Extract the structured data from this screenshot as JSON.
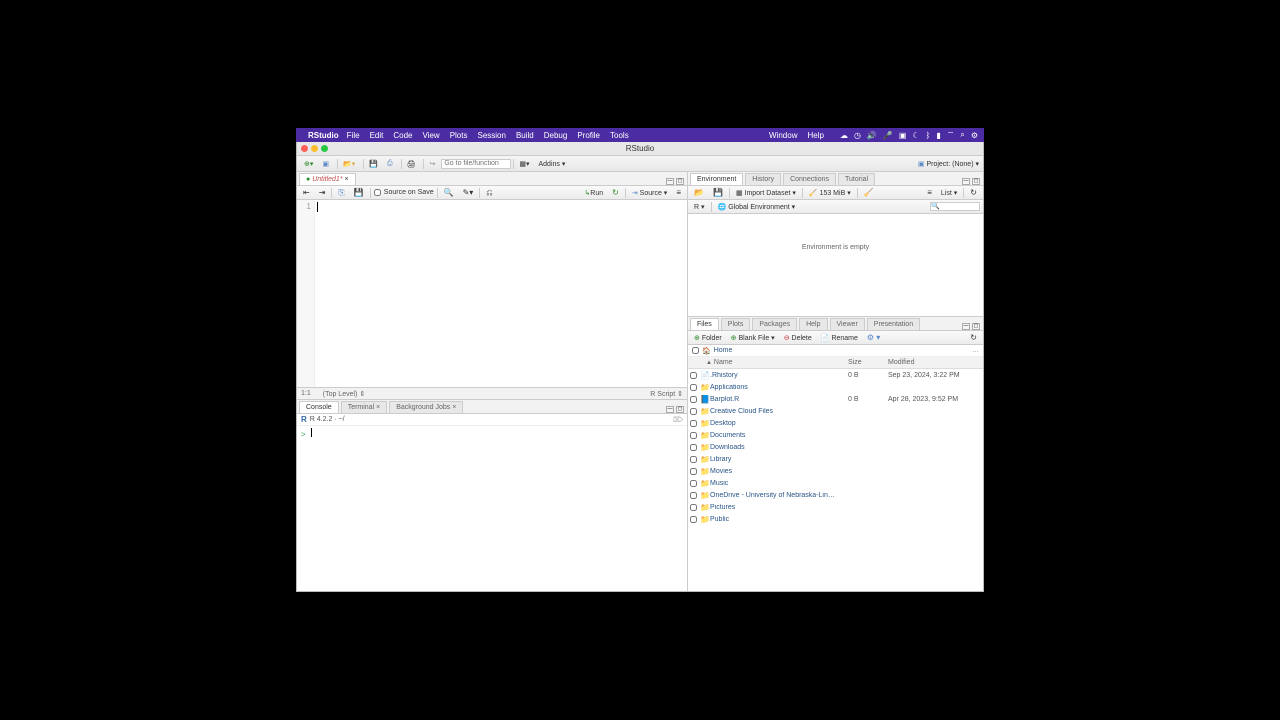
{
  "menubar": {
    "app": "RStudio",
    "items": [
      "File",
      "Edit",
      "Code",
      "View",
      "Plots",
      "Session",
      "Build",
      "Debug",
      "Profile",
      "Tools"
    ],
    "right": [
      "Window",
      "Help"
    ]
  },
  "window_title": "RStudio",
  "toolbar": {
    "goto_placeholder": "Go to file/function",
    "addins": "Addins",
    "project_label": "Project: (None)"
  },
  "source": {
    "tab_name": "Untitled1",
    "modified_marker": "*",
    "source_on_save": "Source on Save",
    "run": "Run",
    "source_btn": "Source",
    "line_number": "1",
    "status_left": "1:1",
    "status_mid": "(Top Level)",
    "status_right": "R Script"
  },
  "console": {
    "tabs": [
      "Console",
      "Terminal",
      "Background Jobs"
    ],
    "info": "R 4.2.2 · ~/",
    "prompt": ">"
  },
  "environment": {
    "tabs": [
      "Environment",
      "History",
      "Connections",
      "Tutorial"
    ],
    "import": "Import Dataset",
    "memory": "153 MiB",
    "list_mode": "List",
    "scope_lang": "R",
    "scope": "Global Environment",
    "empty_msg": "Environment is empty"
  },
  "files": {
    "tabs": [
      "Files",
      "Plots",
      "Packages",
      "Help",
      "Viewer",
      "Presentation"
    ],
    "btn_folder": "Folder",
    "btn_blank": "Blank File",
    "btn_delete": "Delete",
    "btn_rename": "Rename",
    "breadcrumb_home": "Home",
    "headers": {
      "name": "Name",
      "size": "Size",
      "modified": "Modified"
    },
    "items": [
      {
        "icon": "rhistory",
        "name": ".Rhistory",
        "size": "0 B",
        "modified": "Sep 23, 2024, 3:22 PM"
      },
      {
        "icon": "folder",
        "name": "Applications",
        "size": "",
        "modified": ""
      },
      {
        "icon": "rscript",
        "name": "Barplot.R",
        "size": "0 B",
        "modified": "Apr 28, 2023, 9:52 PM"
      },
      {
        "icon": "folder",
        "name": "Creative Cloud Files",
        "size": "",
        "modified": ""
      },
      {
        "icon": "folder",
        "name": "Desktop",
        "size": "",
        "modified": ""
      },
      {
        "icon": "folder",
        "name": "Documents",
        "size": "",
        "modified": ""
      },
      {
        "icon": "folder",
        "name": "Downloads",
        "size": "",
        "modified": ""
      },
      {
        "icon": "folder",
        "name": "Library",
        "size": "",
        "modified": ""
      },
      {
        "icon": "folder",
        "name": "Movies",
        "size": "",
        "modified": ""
      },
      {
        "icon": "folder",
        "name": "Music",
        "size": "",
        "modified": ""
      },
      {
        "icon": "folder",
        "name": "OneDrive - University of Nebraska-Lin…",
        "size": "",
        "modified": ""
      },
      {
        "icon": "folder",
        "name": "Pictures",
        "size": "",
        "modified": ""
      },
      {
        "icon": "lockfolder",
        "name": "Public",
        "size": "",
        "modified": ""
      }
    ]
  }
}
